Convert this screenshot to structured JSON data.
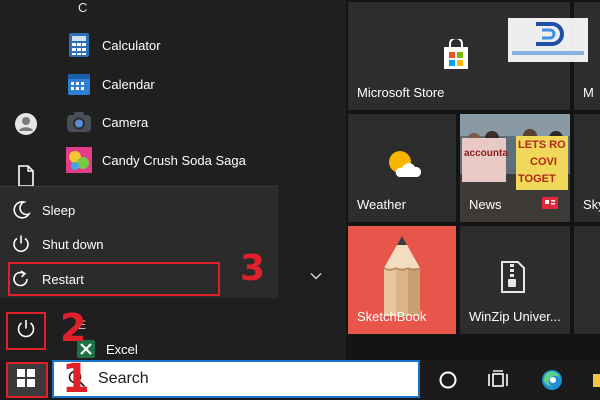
{
  "start_menu": {
    "section_letter": "C",
    "apps": [
      {
        "label": "Calculator",
        "icon": "calculator-icon"
      },
      {
        "label": "Calendar",
        "icon": "calendar-icon"
      },
      {
        "label": "Camera",
        "icon": "camera-icon"
      },
      {
        "label": "Candy Crush Soda Saga",
        "icon": "candy-crush-icon"
      }
    ],
    "next_letter": "E",
    "next_app": {
      "label": "Excel",
      "icon": "excel-icon"
    }
  },
  "power_menu": {
    "items": [
      {
        "label": "Sleep",
        "icon": "moon-icon"
      },
      {
        "label": "Shut down",
        "icon": "power-icon"
      },
      {
        "label": "Restart",
        "icon": "restart-icon"
      }
    ]
  },
  "tiles": [
    {
      "label": "Microsoft Store",
      "icon": "store-icon",
      "bg": "#2d2d2d"
    },
    {
      "label": "Weather",
      "icon": "weather-icon",
      "bg": "#2d2d2d"
    },
    {
      "label": "News",
      "icon": "news-icon",
      "photo_signs": [
        "accounta",
        "LETS RO",
        "COVI",
        "TOGET"
      ]
    },
    {
      "label": "SketchBook",
      "icon": "sketchbook-pencil-icon",
      "bg": "#e8554a"
    },
    {
      "label": "WinZip Univer...",
      "icon": "winzip-icon",
      "bg": "#2d2d2d"
    }
  ],
  "partial_tiles": [
    "M",
    "Sky"
  ],
  "annotations": {
    "step1": "1",
    "step2": "2",
    "step3": "3"
  },
  "taskbar": {
    "search_placeholder": "Search",
    "icons": [
      "start-icon",
      "cortana-icon",
      "task-view-icon",
      "edge-icon",
      "file-explorer-icon"
    ]
  },
  "colors": {
    "start_bg": "#1f1f1f",
    "flyout_bg": "#2b2b2b",
    "tile_bg": "#2d2d2d",
    "highlight_red": "#e0202a",
    "search_border": "#1a73c8"
  }
}
